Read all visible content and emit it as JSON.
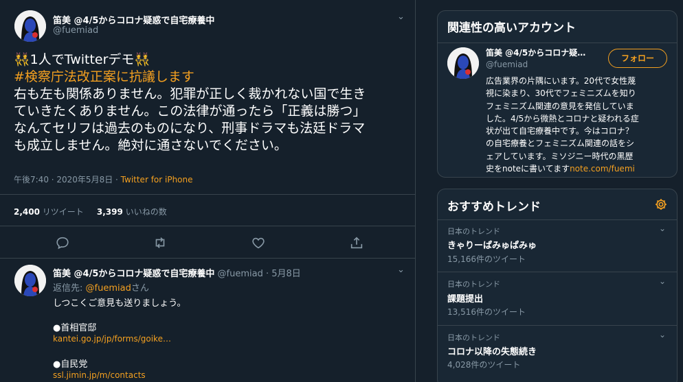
{
  "main_tweet": {
    "name": "笛美 @4/5からコロナ疑惑で自宅療養中",
    "handle": "@fuemiad",
    "line1": "👯1人でTwitterデモ👯",
    "hashtag": "#検察庁法改正案に抗議します",
    "line3": "右も左も関係ありません。犯罪が正しく裁かれない国で生き",
    "line4": "ていきたくありません。この法律が通ったら「正義は勝つ」",
    "line5": "なんてセリフは過去のものになり、刑事ドラマも法廷ドラマ",
    "line6": "も成立しません。絶対に通さないでください。",
    "time": "午後7:40 · 2020年5月8日 · ",
    "source": "Twitter for iPhone",
    "retweets": "2,400",
    "retweets_label": "リツイート",
    "likes": "3,399",
    "likes_label": "いいねの数"
  },
  "reply_tweet": {
    "name": "笛美 @4/5からコロナ疑惑で自宅療養中",
    "meta": " @fuemiad · 5月8日",
    "reply_prefix": "返信先: ",
    "reply_mention": "@fuemiad",
    "reply_suffix": "さん",
    "line1": "しつこくご意見も送りましょう。",
    "item1": "●首相官邸",
    "link1": "kantei.go.jp/jp/forms/goike…",
    "item2": "●自民党",
    "link2": "ssl.jimin.jp/m/contacts"
  },
  "related": {
    "title": "関連性の高いアカウント",
    "name": "笛美 @4/5からコロナ疑…",
    "handle": "@fuemiad",
    "follow_label": "フォロー",
    "bio1": "広告業界の片隅にいます。20代で女性蔑",
    "bio2": "視に染まり、30代でフェミニズムを知り",
    "bio3": "フェミニズム関連の意見を発信していま",
    "bio4": "した。4/5から微熱とコロナと疑われる症",
    "bio5": "状が出て自宅療養中です。今はコロナ？",
    "bio6": "の自宅療養とフェミニズム関連の話をシ",
    "bio7": "ェアしています。ミソジニー時代の黒歴",
    "bio8": "史をnoteに書いてます",
    "bio_link": "note.com/fuemi"
  },
  "trends": {
    "title": "おすすめトレンド",
    "items": [
      {
        "label": "日本のトレンド",
        "name": "きゃりーぱみゅぱみゅ",
        "count": "15,166件のツイート"
      },
      {
        "label": "日本のトレンド",
        "name": "課題提出",
        "count": "13,516件のツイート"
      },
      {
        "label": "日本のトレンド",
        "name": "コロナ以降の失態続き",
        "count": "4,028件のツイート"
      }
    ]
  },
  "colors": {
    "background": "#15202b",
    "card": "#192734",
    "accent": "#f4a020",
    "muted": "#8899a6",
    "border": "#38444d"
  }
}
